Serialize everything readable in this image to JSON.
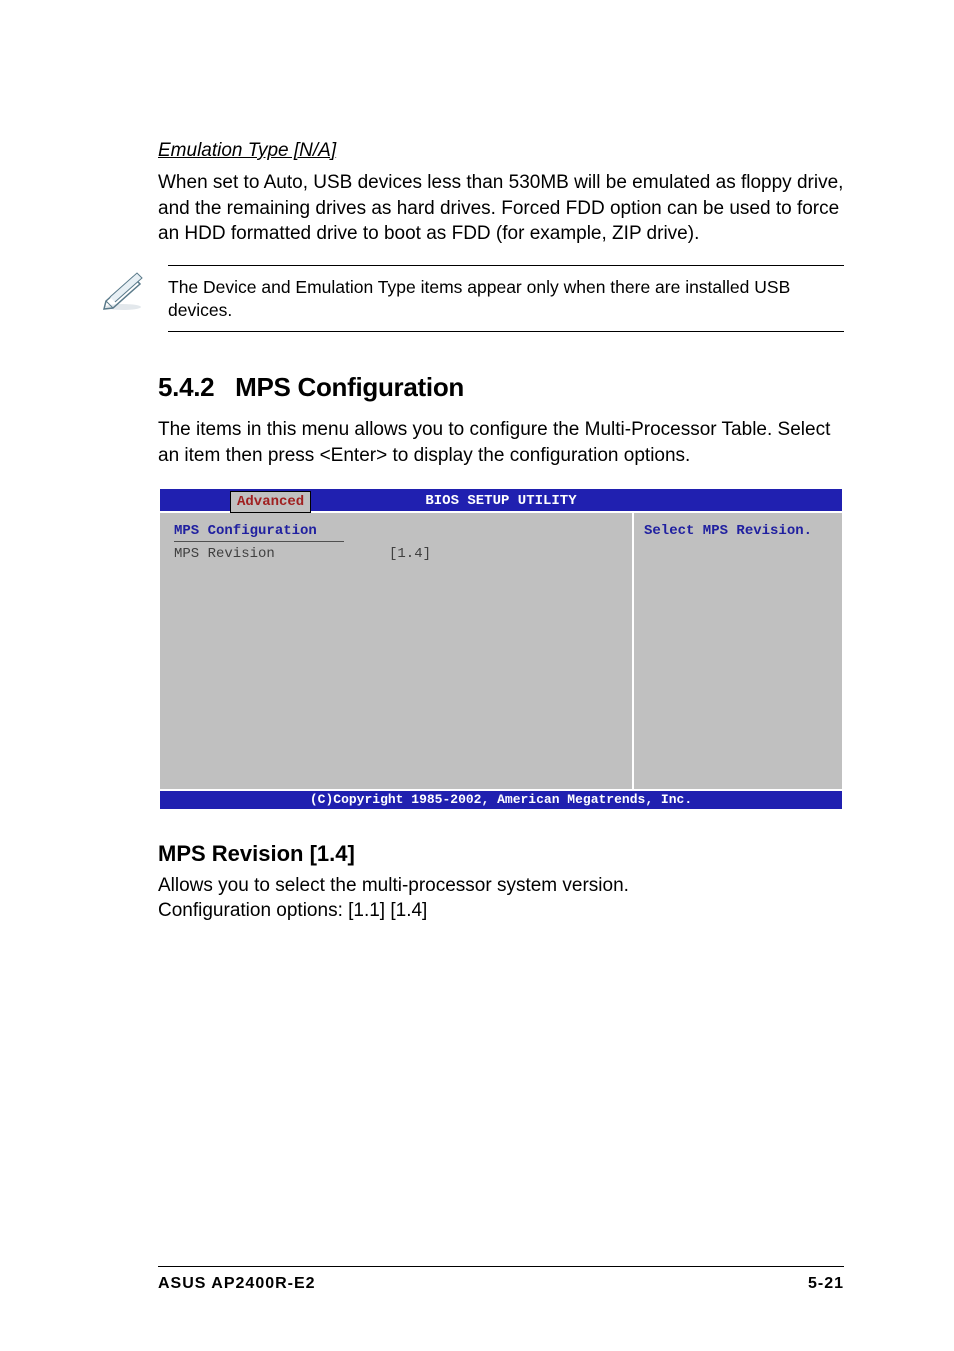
{
  "emulation": {
    "title": "Emulation Type [N/A]",
    "body": "When set to Auto, USB devices less than 530MB will be emulated as floppy drive, and the remaining drives as hard drives. Forced FDD option can be used to force an HDD formatted drive to boot as FDD (for example, ZIP drive)."
  },
  "note": {
    "text": "The Device and Emulation Type items appear only when there are installed USB devices."
  },
  "section": {
    "number": "5.4.2",
    "title": "MPS Configuration",
    "intro": "The items in this menu allows you to configure the Multi-Processor Table. Select an item then press <Enter> to display the configuration options."
  },
  "bios": {
    "header_title": "BIOS SETUP UTILITY",
    "tab": "Advanced",
    "left_title": "MPS Configuration",
    "option_label": "MPS Revision",
    "option_value": "[1.4]",
    "right_help": "Select MPS Revision.",
    "footer": "(C)Copyright 1985-2002, American Megatrends, Inc."
  },
  "mps_revision": {
    "heading": "MPS Revision [1.4]",
    "line1": "Allows you to select the multi-processor system version.",
    "line2": "Configuration options: [1.1] [1.4]"
  },
  "footer": {
    "left": "ASUS AP2400R-E2",
    "right": "5-21"
  }
}
